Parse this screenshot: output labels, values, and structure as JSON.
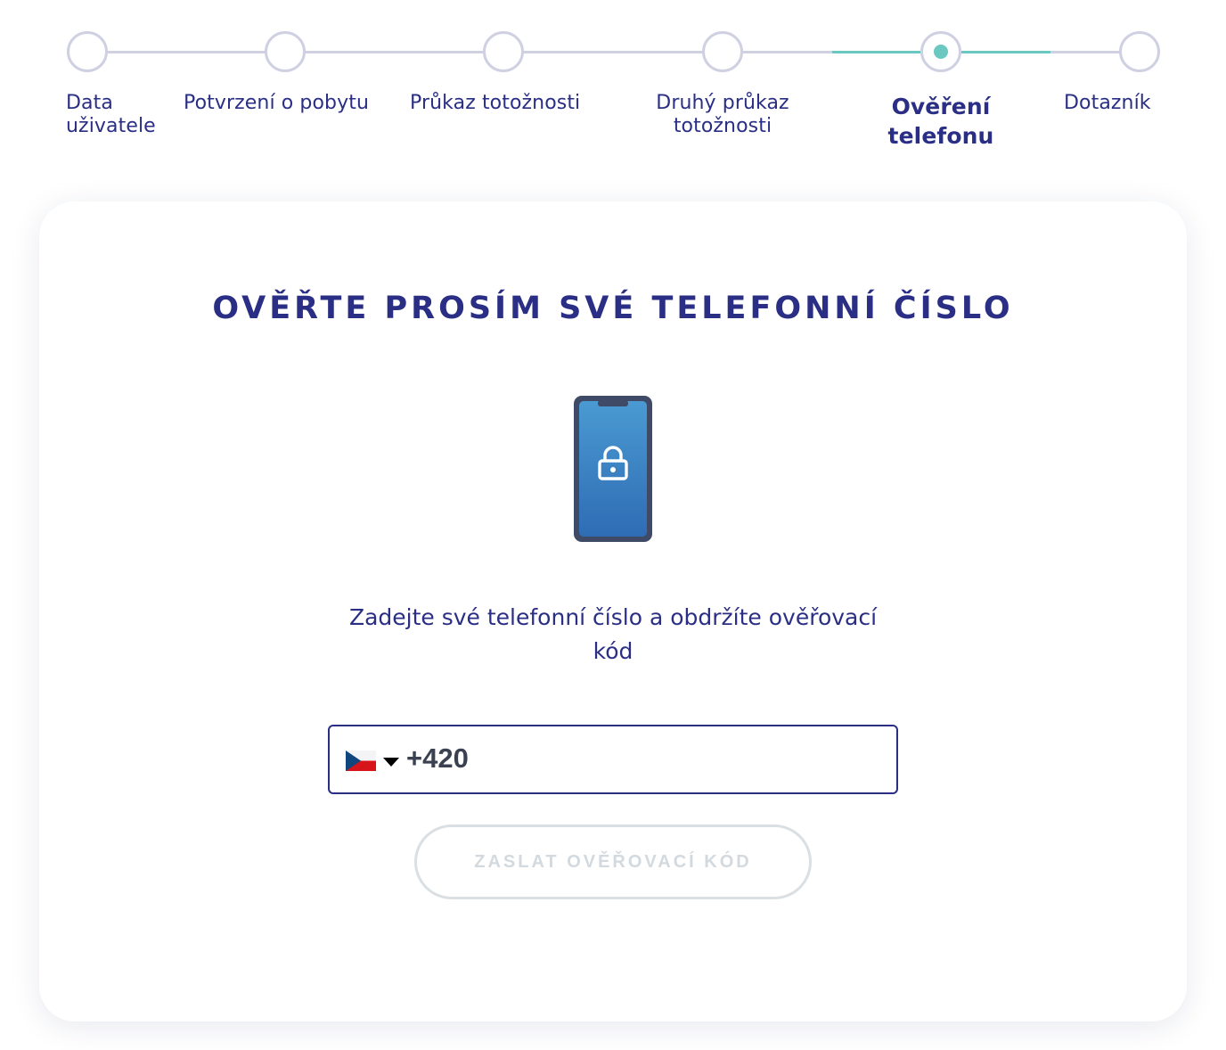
{
  "stepper": {
    "steps": [
      {
        "label": "Data uživatele",
        "state": "default"
      },
      {
        "label": "Potvrzení o pobytu",
        "state": "default"
      },
      {
        "label": "Průkaz totožnosti",
        "state": "default"
      },
      {
        "label": "Druhý průkaz totožnosti",
        "state": "default"
      },
      {
        "label": "Ověření telefonu",
        "state": "current"
      },
      {
        "label": "Dotazník",
        "state": "default"
      }
    ],
    "colors": {
      "inactive": "#cfd0e2",
      "active": "#6bc8c1",
      "text": "#2a2f85"
    }
  },
  "card": {
    "title": "OVĚŘTE PROSÍM SVÉ TELEFONNÍ ČÍSLO",
    "icon": "phone-lock-icon",
    "subtitle": "Zadejte své telefonní číslo a obdržíte ověřovací kód",
    "phone_input": {
      "country": "CZ",
      "flag_icon": "czech-flag-icon",
      "value": "+420"
    },
    "send_button": "ZASLAT OVĚŘOVACÍ KÓD"
  }
}
